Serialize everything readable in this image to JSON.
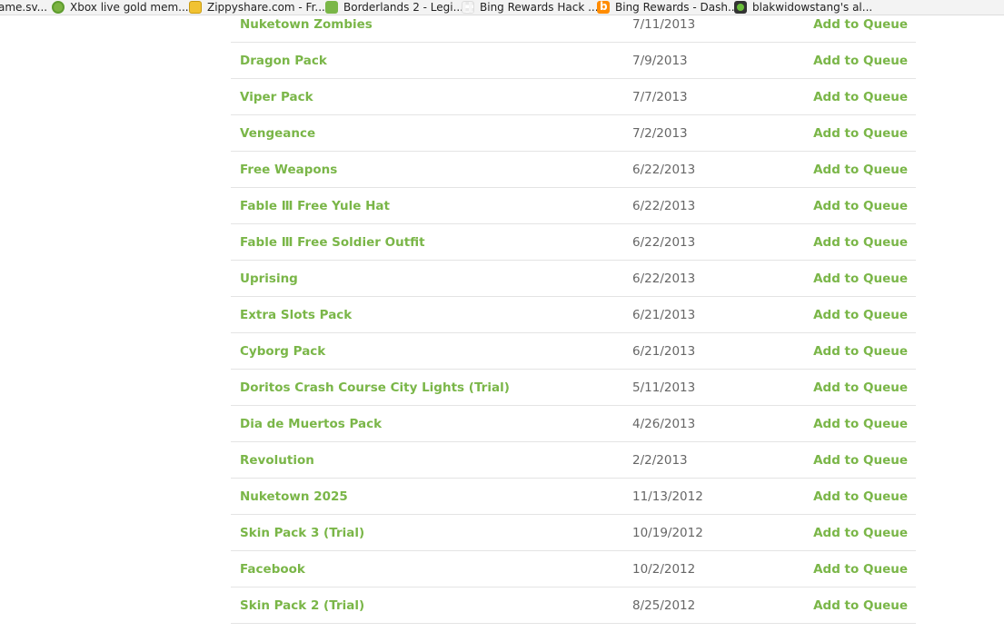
{
  "bookmarks": [
    {
      "label": "ame.sv...",
      "icon": "none"
    },
    {
      "label": "Xbox live gold mem...",
      "icon": "xbox-icon"
    },
    {
      "label": "Zippyshare.com - Fr...",
      "icon": "zippyshare-icon"
    },
    {
      "label": "Borderlands 2 - Legi...",
      "icon": "borderlands-icon"
    },
    {
      "label": "Bing Rewards Hack ...",
      "icon": "grid-icon"
    },
    {
      "label": "Bing Rewards - Dash...",
      "icon": "bing-icon"
    },
    {
      "label": "blakwidowstang's al...",
      "icon": "green-dot-icon"
    }
  ],
  "list": {
    "queue_label": "Add to Queue",
    "items": [
      {
        "title": "Nuketown Zombies",
        "date": "7/11/2013"
      },
      {
        "title": "Dragon Pack",
        "date": "7/9/2013"
      },
      {
        "title": "Viper Pack",
        "date": "7/7/2013"
      },
      {
        "title": "Vengeance",
        "date": "7/2/2013"
      },
      {
        "title": "Free Weapons",
        "date": "6/22/2013"
      },
      {
        "title": "Fable Ⅲ Free Yule Hat",
        "date": "6/22/2013"
      },
      {
        "title": "Fable Ⅲ Free Soldier Outfit",
        "date": "6/22/2013"
      },
      {
        "title": "Uprising",
        "date": "6/22/2013"
      },
      {
        "title": "Extra Slots Pack",
        "date": "6/21/2013"
      },
      {
        "title": "Cyborg Pack",
        "date": "6/21/2013"
      },
      {
        "title": "Doritos Crash Course City Lights (Trial)",
        "date": "5/11/2013"
      },
      {
        "title": "Dia de Muertos Pack",
        "date": "4/26/2013"
      },
      {
        "title": "Revolution",
        "date": "2/2/2013"
      },
      {
        "title": "Nuketown 2025",
        "date": "11/13/2012"
      },
      {
        "title": "Skin Pack 3 (Trial)",
        "date": "10/19/2012"
      },
      {
        "title": "Facebook",
        "date": "10/2/2012"
      },
      {
        "title": "Skin Pack 2 (Trial)",
        "date": "8/25/2012"
      }
    ]
  },
  "colors": {
    "accent_green": "#7ab648",
    "date_gray": "#666666",
    "divider": "#e4e4e4"
  }
}
